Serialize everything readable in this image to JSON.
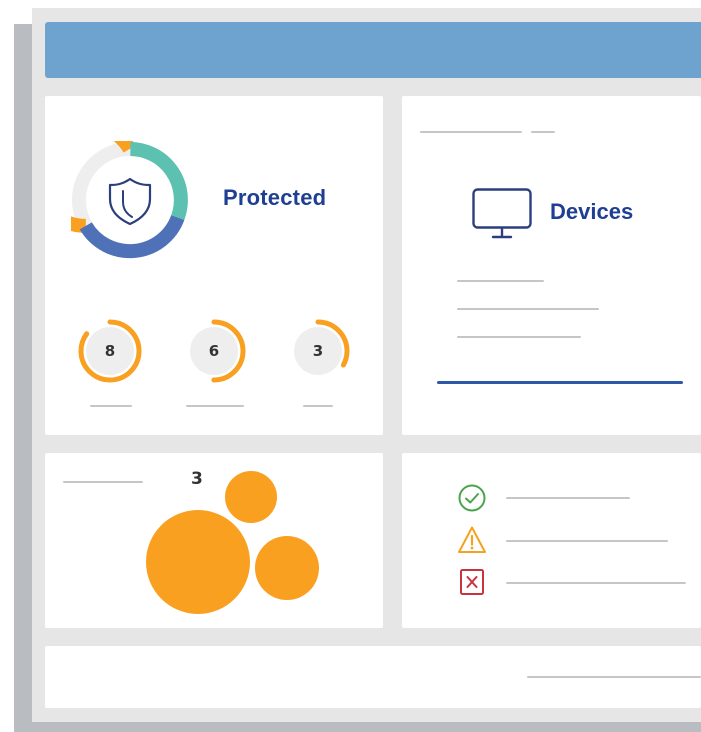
{
  "colors": {
    "accent_orange": "#f9a020",
    "accent_teal": "#5cc1b1",
    "accent_blue": "#4f71b8",
    "title_blue": "#1f3f94",
    "header_bar": "#6fa3cf",
    "ok_green": "#4aa54a",
    "warn_orange": "#f5a21e",
    "error_red": "#c7333e"
  },
  "protection": {
    "status_label": "Protected",
    "icon": "shield-icon",
    "gauges": [
      {
        "count": "8",
        "fill": 0.85
      },
      {
        "count": "6",
        "fill": 0.5
      },
      {
        "count": "3",
        "fill": 0.33
      }
    ]
  },
  "devices": {
    "label": "Devices",
    "icon": "monitor-icon"
  },
  "threats": {
    "count": "3"
  },
  "status_list": {
    "items": [
      {
        "icon": "check-circle-icon",
        "state": "ok"
      },
      {
        "icon": "warning-triangle-icon",
        "state": "warning"
      },
      {
        "icon": "error-x-icon",
        "state": "error"
      }
    ]
  }
}
